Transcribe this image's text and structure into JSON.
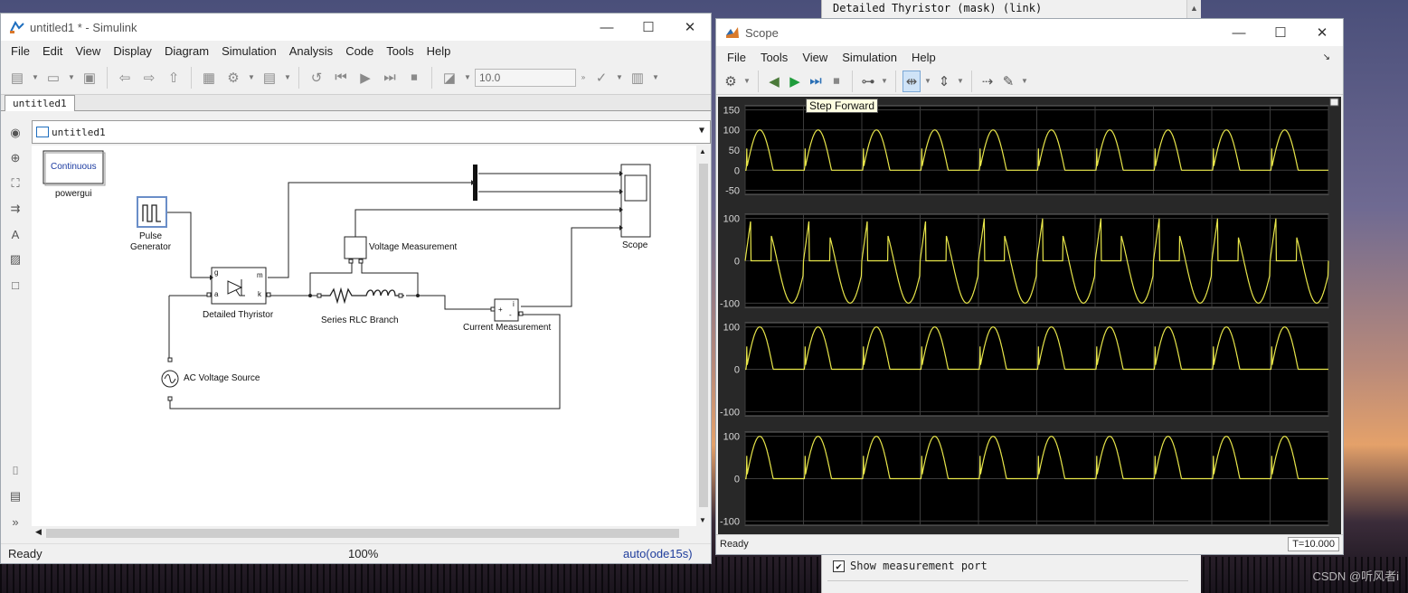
{
  "mask_dialog": {
    "title": "Detailed Thyristor (mask) (link)",
    "checkbox_label": "Show measurement port",
    "checkbox_mark": "✔"
  },
  "simulink": {
    "title": "untitled1 * - Simulink",
    "window_controls": {
      "min": "—",
      "max": "☐",
      "close": "✕"
    },
    "menu": [
      "File",
      "Edit",
      "View",
      "Display",
      "Diagram",
      "Simulation",
      "Analysis",
      "Code",
      "Tools",
      "Help"
    ],
    "stop_time": "10.0",
    "tab": "untitled1",
    "address": "untitled1",
    "blocks": {
      "powergui_text": "Continuous",
      "powergui": "powergui",
      "pulse": "Pulse\nGenerator",
      "thyristor": "Detailed Thyristor",
      "thyristor_ports": {
        "g": "g",
        "a": "a",
        "m": "m",
        "k": "k"
      },
      "voltage_meas": "Voltage Measurement",
      "rlc": "Series RLC Branch",
      "current_meas": "Current Measurement",
      "current_ports": {
        "plus": "+",
        "minus": "-",
        "i": "i"
      },
      "ac_source": "AC Voltage Source",
      "scope": "Scope"
    },
    "status": {
      "left": "Ready",
      "zoom": "100%",
      "solver": "auto(ode15s)"
    }
  },
  "scope": {
    "title": "Scope",
    "window_controls": {
      "min": "—",
      "max": "☐",
      "close": "✕"
    },
    "menu": [
      "File",
      "Tools",
      "View",
      "Simulation",
      "Help"
    ],
    "tooltip": "Step Forward",
    "status": "Ready",
    "time": "T=10.000"
  },
  "colors": {
    "trace": "#e8e64a",
    "plot_bg": "#000000",
    "frame_bg": "#282828",
    "grid": "#3c3c3c"
  },
  "chart_data": [
    {
      "type": "line",
      "title": "",
      "x": [
        0,
        1,
        2,
        3,
        4,
        5,
        6,
        7,
        8,
        9,
        10
      ],
      "ylim": [
        -60,
        160
      ],
      "yticks": [
        -50,
        0,
        50,
        100,
        150
      ],
      "series": [
        {
          "shape": "half-sine pulse after firing",
          "period": 1,
          "peak": 100,
          "fire_phase": 0.0,
          "off_phase": 0.5
        }
      ]
    },
    {
      "type": "line",
      "title": "",
      "x": [
        0,
        1,
        2,
        3,
        4,
        5,
        6,
        7,
        8,
        9,
        10
      ],
      "ylim": [
        -110,
        110
      ],
      "yticks": [
        -100,
        0,
        100
      ],
      "series": [
        {
          "shape": "voltage across thyristor",
          "period": 1,
          "amplitude": 100
        }
      ]
    },
    {
      "type": "line",
      "title": "",
      "x": [
        0,
        1,
        2,
        3,
        4,
        5,
        6,
        7,
        8,
        9,
        10
      ],
      "ylim": [
        -110,
        110
      ],
      "yticks": [
        -100,
        0,
        100
      ],
      "series": [
        {
          "shape": "half-sine pulse",
          "period": 1,
          "peak": 100
        }
      ]
    },
    {
      "type": "line",
      "title": "",
      "x": [
        0,
        1,
        2,
        3,
        4,
        5,
        6,
        7,
        8,
        9,
        10
      ],
      "ylim": [
        -110,
        110
      ],
      "yticks": [
        -100,
        0,
        100
      ],
      "series": [
        {
          "shape": "half-sine pulse",
          "period": 1,
          "peak": 100
        }
      ]
    }
  ],
  "watermark": "CSDN @听风者i"
}
